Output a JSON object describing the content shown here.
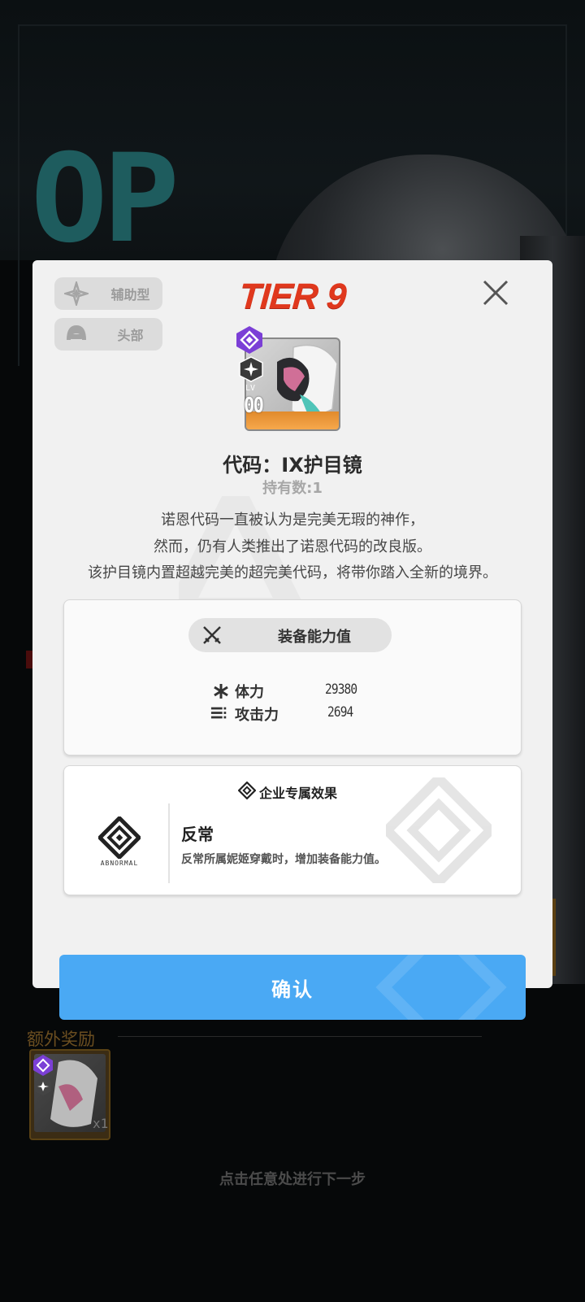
{
  "background": {
    "letters": "OP",
    "bonus_title": "额外奖励",
    "bonus_quantity": "x1",
    "hint": "点击任意处进行下一步"
  },
  "modal": {
    "tags": {
      "type_label": "辅助型",
      "type_icon": "supporter-icon",
      "slot_label": "头部",
      "slot_icon": "helmet-icon"
    },
    "tier": "TIER 9",
    "close_icon": "close-icon",
    "item": {
      "level_label": "LV",
      "level_value": "00",
      "rarity_icon": "rarity-gem-icon",
      "class_icon": "supporter-class-icon",
      "name": "代码：IX护目镜",
      "count": "持有数:1",
      "description": [
        "诺恩代码一直被认为是完美无瑕的神作，",
        "然而，仍有人类推出了诺恩代码的改良版。",
        "该护目镜内置超越完美的超完美代码，将带你踏入全新的境界。"
      ]
    },
    "stats": {
      "header": "装备能力值",
      "header_icon": "crossed-swords-icon",
      "rows": [
        {
          "icon": "asterisk-icon",
          "label": "体力",
          "value": "29380"
        },
        {
          "icon": "bullets-icon",
          "label": "攻击力",
          "value": "2694"
        }
      ]
    },
    "corp": {
      "title": "企业专属效果",
      "title_icon": "diamond-icon",
      "logo_text": "ABNORMAL",
      "name": "反常",
      "description": "反常所属妮姬穿戴时，增加装备能力值。"
    },
    "confirm_label": "确认"
  },
  "colors": {
    "tier_red": "#e0381d",
    "confirm_blue": "#4aa9f4",
    "rarity_purple": "#7b3fd6",
    "item_orange": "#f6a84c"
  }
}
